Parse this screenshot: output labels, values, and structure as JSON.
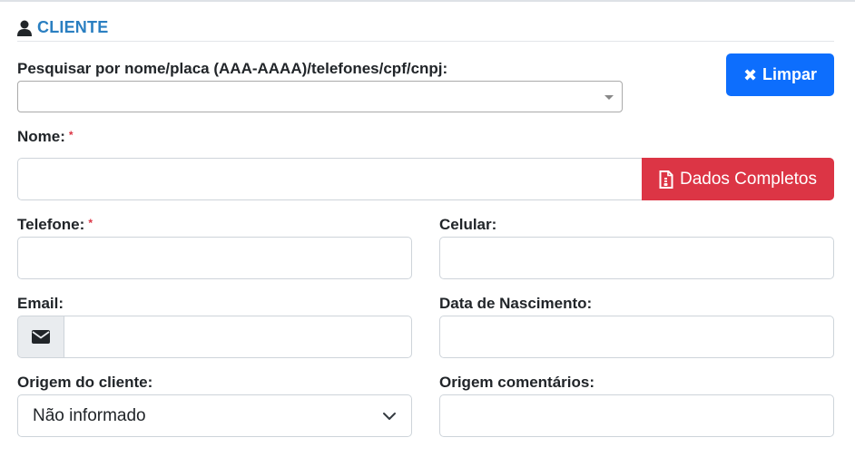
{
  "section": {
    "title": "CLIENTE",
    "icon": "user-icon"
  },
  "search": {
    "label": "Pesquisar por nome/placa (AAA-AAAA)/telefones/cpf/cnpj:",
    "value": ""
  },
  "buttons": {
    "limpar": {
      "label": "Limpar",
      "icon": "times-icon",
      "color": "#0d6efd"
    },
    "dados_completos": {
      "label": "Dados Completos",
      "icon": "file-document-icon",
      "color": "#dc3545"
    }
  },
  "fields": {
    "nome": {
      "label": "Nome:",
      "required_mark": "*",
      "value": ""
    },
    "telefone": {
      "label": "Telefone:",
      "required_mark": "*",
      "value": ""
    },
    "celular": {
      "label": "Celular:",
      "value": ""
    },
    "email": {
      "label": "Email:",
      "icon": "envelope-icon",
      "value": ""
    },
    "data_nascimento": {
      "label": "Data de Nascimento:",
      "value": ""
    },
    "origem_cliente": {
      "label": "Origem do cliente:",
      "selected": "Não informado"
    },
    "origem_comentarios": {
      "label": "Origem comentários:",
      "value": ""
    }
  },
  "colors": {
    "accent": "#2a7fc1",
    "required": "#dc3545"
  }
}
